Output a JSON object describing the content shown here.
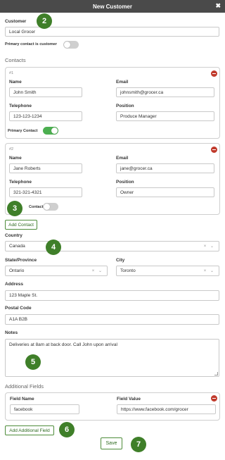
{
  "window": {
    "title": "New Customer",
    "close_glyph": "✖"
  },
  "customer": {
    "label": "Customer",
    "value": "Local Grocer",
    "primary_toggle_label": "Primary contact is customer",
    "primary_toggle_on": false
  },
  "contacts": {
    "section_title": "Contacts",
    "labels": {
      "name": "Name",
      "email": "Email",
      "telephone": "Telephone",
      "position": "Position",
      "primary": "Primary Contact"
    },
    "items": [
      {
        "index": "#1",
        "name": "John Smith",
        "email": "johnsmith@grocer.ca",
        "telephone": "123-123-1234",
        "position": "Produce Manager",
        "primary": true
      },
      {
        "index": "#2",
        "name": "Jane Roberts",
        "email": "jane@grocer.ca",
        "telephone": "321-321-4321",
        "position": "Owner",
        "primary": false,
        "primary_label_visible": "Contact"
      }
    ],
    "add_button": "Add Contact"
  },
  "country": {
    "label": "Country",
    "value": "Canada",
    "clear_glyph": "×",
    "arrow_glyph": "⌄"
  },
  "state": {
    "label": "State/Province",
    "value": "Ontario"
  },
  "city": {
    "label": "City",
    "value": "Toronto"
  },
  "address": {
    "label": "Address",
    "value": "123 Maple St."
  },
  "postal": {
    "label": "Postal Code",
    "value": "A1A B2B"
  },
  "notes": {
    "label": "Notes",
    "value": "Deliveries at 8am at back door. Call John upon arrival"
  },
  "additional": {
    "section_title": "Additional Fields",
    "labels": {
      "field_name": "Field Name",
      "field_value": "Field Value"
    },
    "items": [
      {
        "field_name": "facebook",
        "field_value": "https://www.facebook.com/grocer"
      }
    ],
    "add_button": "Add Additional Field"
  },
  "save_button": "Save",
  "badges": [
    "2",
    "3",
    "4",
    "5",
    "6",
    "7"
  ],
  "colors": {
    "titlebar": "#4a4a4a",
    "accent_green": "#3f7f29",
    "remove_red": "#c0392b",
    "toggle_on": "#4caf50"
  }
}
